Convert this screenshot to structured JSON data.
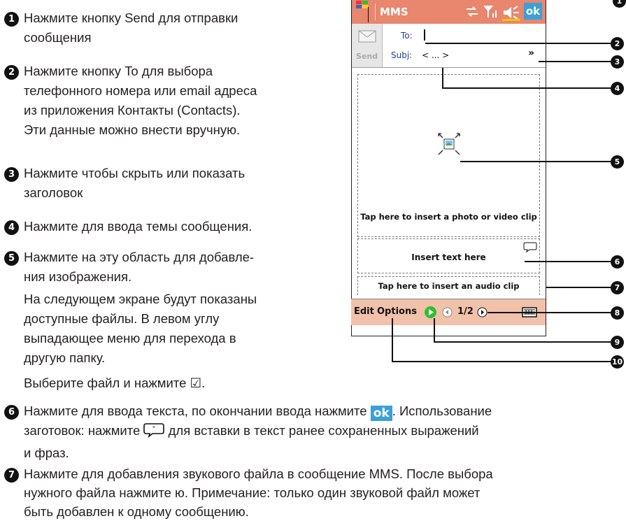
{
  "instructions": [
    {
      "num": "1",
      "lines": [
        "Нажмите кнопку Send для отправки",
        "сообщения"
      ]
    },
    {
      "num": "2",
      "lines": [
        "Нажмите кнопку To для выбора",
        "телефонного номера или email адреса",
        "из приложения Контакты (Contacts).",
        "Эти данные можно внести вручную."
      ]
    },
    {
      "num": "3",
      "lines": [
        "Нажмите чтобы скрыть или показать",
        "заголовок"
      ]
    },
    {
      "num": "4",
      "lines": [
        "Нажмите для ввода темы сообщения."
      ]
    },
    {
      "num": "5",
      "lines": [
        "Нажмите на эту область для добавле-",
        "ния изображения."
      ]
    }
  ],
  "item5_extra": {
    "para1": [
      "На следующем экране будут показаны",
      "доступные файлы. В левом углу",
      "выпадающее меню для перехода в",
      "другую папку."
    ],
    "para2": "Выберите файл и нажмите ☑."
  },
  "item6": {
    "num": "6",
    "line1_a": "Нажмите для ввода текста, по окончании ввода нажмите",
    "line1_b": ". Использование",
    "line2_a": "заготовок: нажмите",
    "line2_b": "для вставки в текст ранее сохраненных выражений",
    "line3": "и фраз."
  },
  "item7": {
    "num": "7",
    "lines": [
      "Нажмите для добавления звукового файла в сообщение MMS. После выбора",
      "нужного файла нажмите ю. Примечание: только один звуковой файл может",
      "быть добавлен к одному сообщению."
    ]
  },
  "screen": {
    "title": "MMS",
    "ok_label": "ok",
    "send_label": "Send",
    "to_label": "To:",
    "subj_label": "Subj:",
    "subj_value": "< ... >",
    "photo_prompt": "Tap here to insert a photo or video clip",
    "text_prompt": "Insert text here",
    "audio_prompt": "Tap here to insert an audio clip",
    "menu_edit": "Edit",
    "menu_options": "Options",
    "page_indicator": "1/2"
  },
  "callouts": [
    "1",
    "2",
    "3",
    "4",
    "5",
    "6",
    "7",
    "8",
    "9",
    "10"
  ],
  "colors": {
    "titlebar": "#e8866e",
    "ok_badge": "#3aa0d8",
    "play_green": "#2fbf2f"
  }
}
